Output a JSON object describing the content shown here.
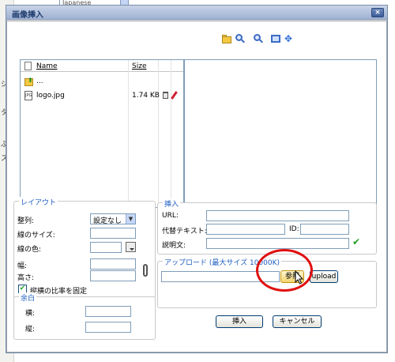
{
  "background": {
    "language_select": "Japanese",
    "side_glyphs": [
      "ジ",
      "タ",
      "ぷ",
      "ス"
    ]
  },
  "dialog": {
    "title": "画像挿入",
    "close_label": "×"
  },
  "toolbar": {
    "icons": [
      "folder-icon",
      "zoom-in-icon",
      "zoom-out-icon",
      "fit-icon",
      "move-icon"
    ]
  },
  "file_list": {
    "columns": {
      "name": "Name",
      "size": "Size"
    },
    "up_label": "...",
    "files": [
      {
        "name": "logo.jpg",
        "size": "1.74 KB"
      }
    ]
  },
  "layout": {
    "legend": "レイアウト",
    "align_label": "整列:",
    "align_value": "設定なし",
    "border_size_label": "線のサイズ:",
    "border_color_label": "線の色:",
    "width_label": "幅:",
    "height_label": "高さ:",
    "keep_ratio_label": "縦横の比率を固定",
    "keep_ratio_checked": true
  },
  "margin": {
    "legend": "余白",
    "horizontal_label": "横:",
    "vertical_label": "縦:"
  },
  "insert": {
    "legend": "挿入",
    "url_label": "URL:",
    "alt_label": "代替テキスト:",
    "id_label": "ID:",
    "desc_label": "説明文:"
  },
  "upload": {
    "legend": "アップロード (最大サイズ 10000K)",
    "browse_label": "参照",
    "upload_label": "upload"
  },
  "footer": {
    "insert_label": "挿入",
    "cancel_label": "キャンセル"
  },
  "colors": {
    "accent": "#1d5ebf",
    "annotation": "#e01010"
  }
}
